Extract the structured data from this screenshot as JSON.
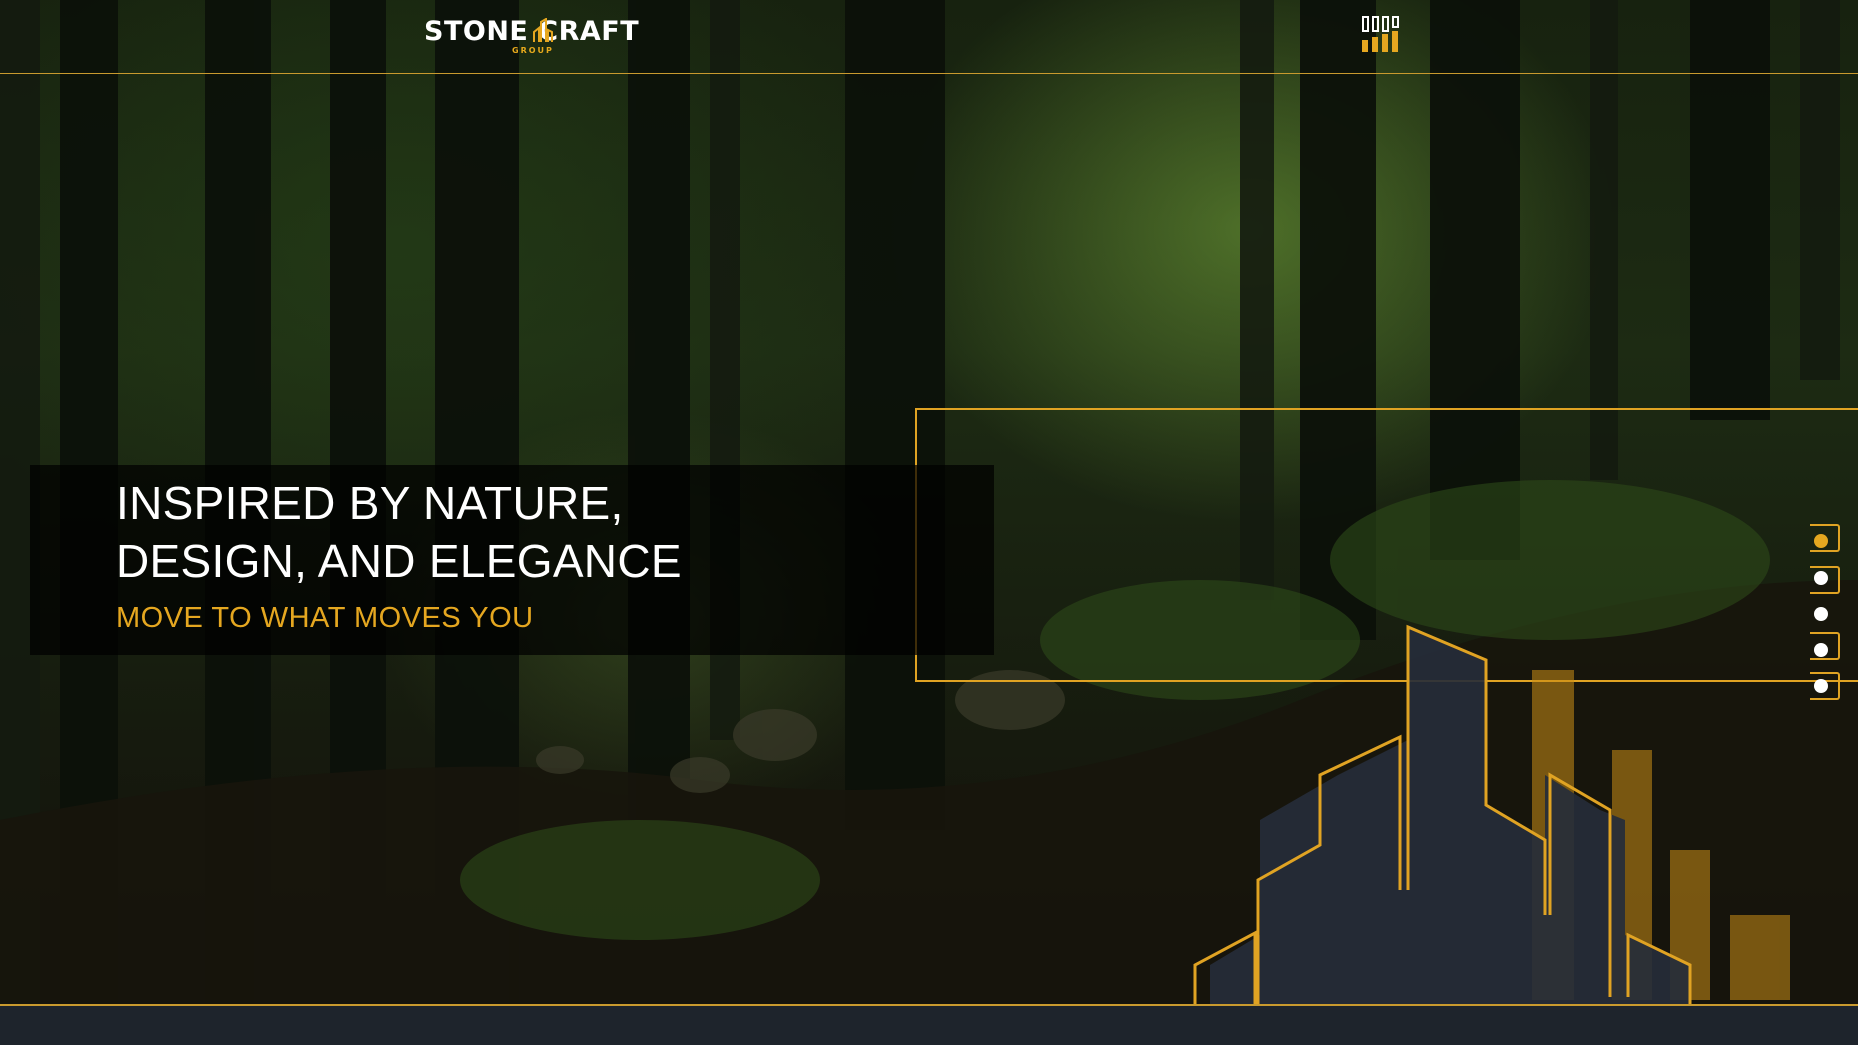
{
  "brand": {
    "name": "STONE CRAFT",
    "tagline": "GROUP",
    "accent": "#e5a720"
  },
  "header": {
    "menu_icon": "building-menu-icon"
  },
  "hero": {
    "title": "INSPIRED BY NATURE,\nDESIGN, AND ELEGANCE",
    "subtitle": "MOVE TO WHAT MOVES YOU"
  },
  "slider": {
    "slide_count": 5,
    "active_index": 0
  },
  "colors": {
    "accent": "#e5a720",
    "text": "#ffffff",
    "bottom_bar": "#1e242c"
  }
}
